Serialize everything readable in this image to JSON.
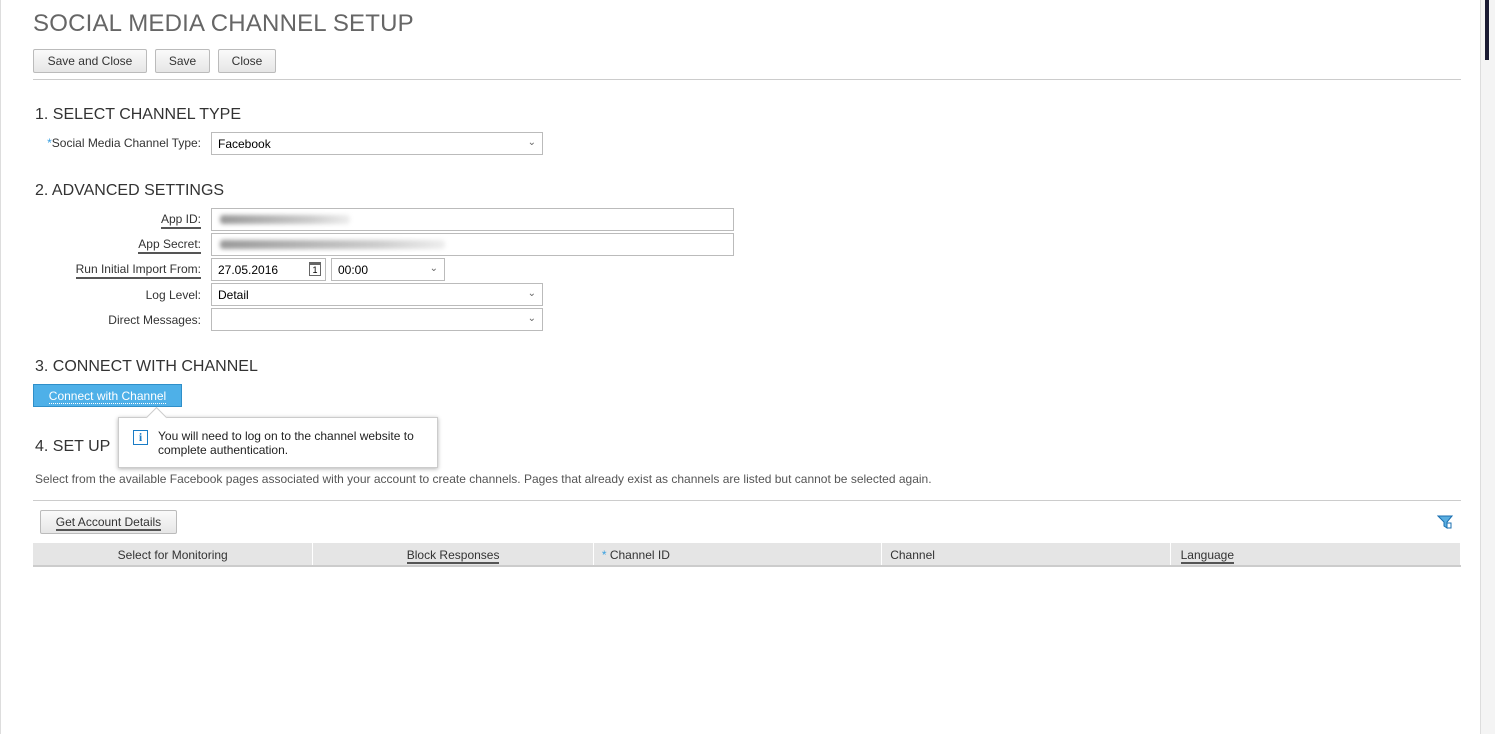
{
  "title": "SOCIAL MEDIA CHANNEL SETUP",
  "toolbar": {
    "save_close": "Save and Close",
    "save": "Save",
    "close": "Close"
  },
  "section1": {
    "heading": "1. SELECT CHANNEL TYPE",
    "channel_type_label": "Social Media Channel Type:",
    "channel_type_value": "Facebook"
  },
  "section2": {
    "heading": "2. ADVANCED SETTINGS",
    "app_id_label": "App ID:",
    "app_secret_label": "App Secret:",
    "import_label": "Run Initial Import From:",
    "import_date": "27.05.2016",
    "import_time": "00:00",
    "log_level_label": "Log Level:",
    "log_level_value": "Detail",
    "direct_messages_label": "Direct Messages:",
    "direct_messages_value": ""
  },
  "section3": {
    "heading": "3. CONNECT WITH CHANNEL",
    "connect_button": "Connect with Channel",
    "tooltip": "You will need to log on to the channel website to complete authentication."
  },
  "section4": {
    "heading": "4. SET UP",
    "description": "Select from the available Facebook pages associated with your account to create channels. Pages that already exist as channels are listed but cannot be selected again.",
    "get_details_button": "Get Account Details",
    "columns": [
      "Select for Monitoring",
      "Block Responses",
      "Channel ID",
      "Channel",
      "Language"
    ]
  },
  "colors": {
    "accent": "#4eb0e8",
    "required": "#3aa0e0"
  }
}
